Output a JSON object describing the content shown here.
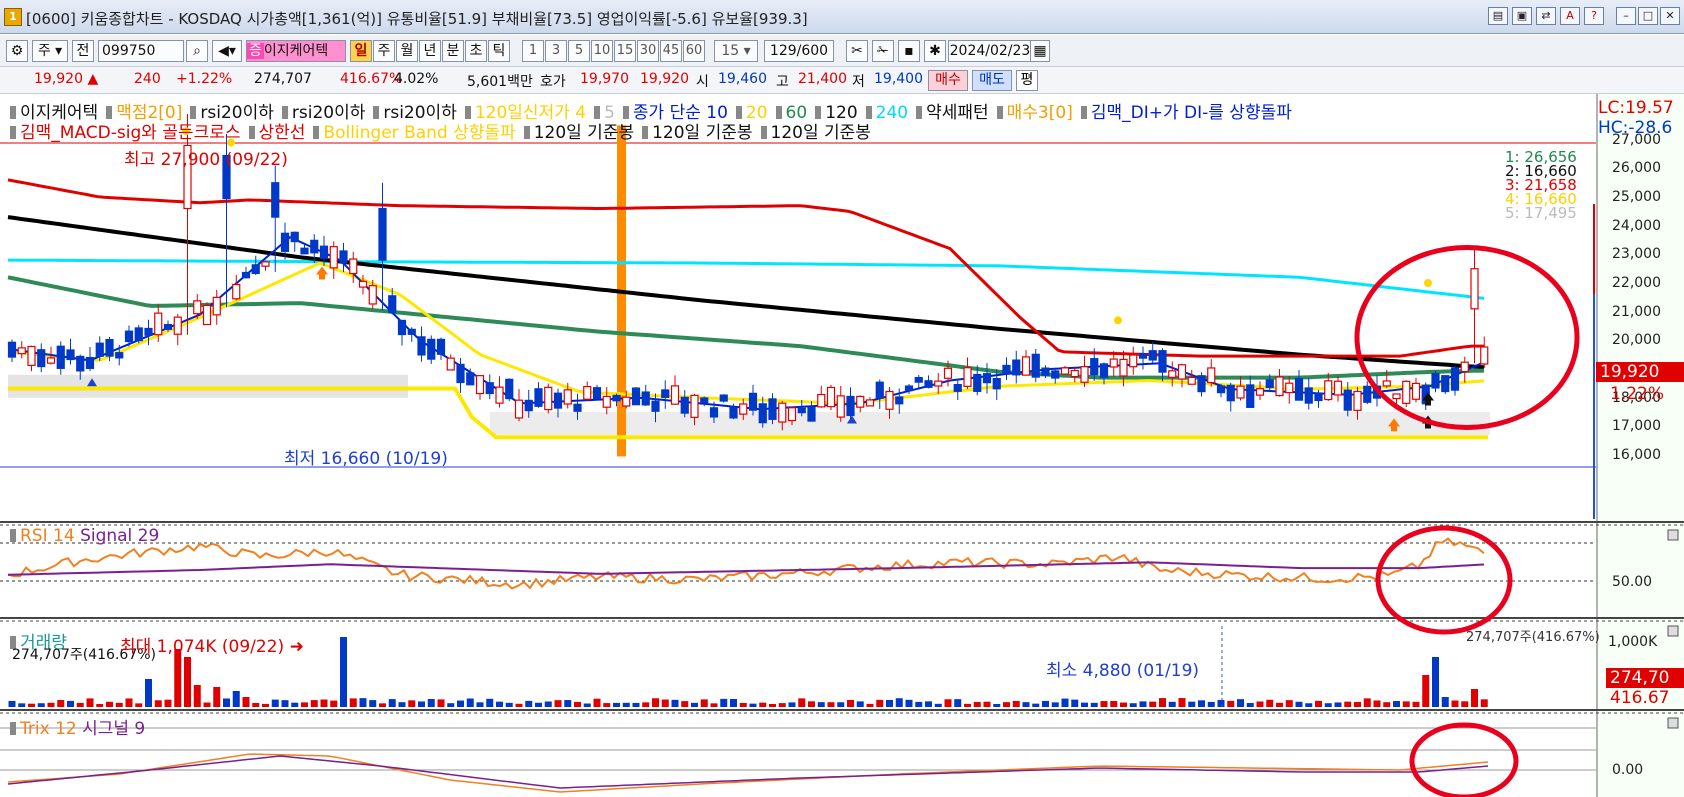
{
  "window": {
    "title": "[0600] 키움종합차트 - KOSDAQ 시가총액[1,361(억)] 유통비율[51.9] 부채비율[73.5] 영업이익률[-5.6] 유보율[939.3]",
    "app_badge": "1"
  },
  "toolbar": {
    "period_select": "주",
    "prev_label": "전",
    "code": "099750",
    "indicator_button": "이지케어텍",
    "indicator_prefix": "증",
    "periods": [
      "일",
      "주",
      "월",
      "년",
      "분",
      "초",
      "틱"
    ],
    "active_period": "일",
    "minute_values": [
      "1",
      "3",
      "5",
      "10",
      "15",
      "30",
      "45",
      "60"
    ],
    "minute_select": "15",
    "count": "129/600",
    "date": "2024/02/23"
  },
  "quote": {
    "price": "19,920",
    "change": "240",
    "change_pct": "+1.22%",
    "volume": "274,707",
    "volume_ratio": "416.67%",
    "turnover_pct": "4.02%",
    "amount": "5,601백만",
    "hoga_label": "호가",
    "ask": "19,970",
    "bid": "19,920",
    "open_label": "시",
    "open": "19,460",
    "high_label": "고",
    "high": "21,400",
    "low_label": "저",
    "low": "19,400",
    "buy_label": "매수",
    "sell_label": "매도",
    "avg_label": "평"
  },
  "legend": {
    "line1": [
      {
        "text": "이지케어텍",
        "color": "#111111",
        "box": true
      },
      {
        "text": "맥점2[0]",
        "color": "#f0a000"
      },
      {
        "text": "rsi20이하",
        "color": "#111111"
      },
      {
        "text": "rsi20이하",
        "color": "#111111"
      },
      {
        "text": "rsi20이하",
        "color": "#111111"
      },
      {
        "text": "120일신저가 4",
        "color": "#ffd000"
      },
      {
        "text": "5",
        "color": "#bbbbbb"
      },
      {
        "text": "종가 단순 10",
        "color": "#0020d0"
      },
      {
        "text": "20",
        "color": "#ffd000"
      },
      {
        "text": "60",
        "color": "#1f8a4f"
      },
      {
        "text": "120",
        "color": "#111111"
      },
      {
        "text": "240",
        "color": "#00d8ff"
      },
      {
        "text": "약세패턴",
        "color": "#111111"
      },
      {
        "text": "매수3[0]",
        "color": "#f0a000"
      },
      {
        "text": "김맥_DI+가 DI-를 상향돌파",
        "color": "#0020d0"
      }
    ],
    "line2": [
      {
        "text": "김맥_MACD-sig와 골든크로스",
        "color": "#e00000"
      },
      {
        "text": "상한선",
        "color": "#e00000"
      },
      {
        "text": "Bollinger Band 상향돌파",
        "color": "#ffd000"
      },
      {
        "text": "120일 기준봉",
        "color": "#111111"
      },
      {
        "text": "120일 기준봉",
        "color": "#111111"
      },
      {
        "text": "120일 기준봉",
        "color": "#111111"
      }
    ],
    "right_lc": "LC:19.57",
    "right_hc": "HC:-28.6"
  },
  "price_chart": {
    "high_label": "최고 27,900 (09/22)",
    "low_label": "최저 16,660 (10/19)",
    "axis_ticks": [
      "27,000",
      "26,000",
      "25,000",
      "24,000",
      "23,000",
      "22,000",
      "21,000",
      "20,000",
      "19,000",
      "18,000",
      "17,000",
      "16,000"
    ],
    "axis_values": [
      27000,
      26000,
      25000,
      24000,
      23000,
      22000,
      21000,
      20000,
      19000,
      18000,
      17000,
      16000
    ],
    "current_price": "19,920",
    "current_pct": "1.22%",
    "ma_labels": [
      {
        "text": "1: 26,656",
        "color": "#1f8a4f"
      },
      {
        "text": "2: 16,660",
        "color": "#111111"
      },
      {
        "text": "3: 21,658",
        "color": "#e00000"
      },
      {
        "text": "4: 16,660",
        "color": "#ffd000"
      },
      {
        "text": "5: 17,495",
        "color": "#bbbbbb"
      }
    ]
  },
  "rsi": {
    "label": "RSI 14",
    "signal_label": "Signal 29",
    "level_label": "50.00"
  },
  "volume": {
    "label": "거래량",
    "left_value": "274,707주(416.67%)",
    "max_label": "최대 1,074K (09/22)",
    "min_label": "최소 4,880 (01/19)",
    "right_value": "274,707주(416.67%)",
    "axis_max": "1,000K",
    "current": "274,70",
    "current_pct": "416.67"
  },
  "trix": {
    "label": "Trix 12",
    "signal_label": "시그널 9",
    "level_label": "0.00"
  },
  "colors": {
    "up": "#e00000",
    "down": "#0038c8",
    "ma10": "#0020d0",
    "ma20": "#ffe800",
    "ma60": "#2e8b57",
    "ma120": "#000000",
    "ma240": "#00e5ff",
    "upper_band": "#e00000",
    "annot": "#e8001c",
    "rsi": "#f08020",
    "signal": "#7a1f8f",
    "vline": "#ff8c00"
  }
}
